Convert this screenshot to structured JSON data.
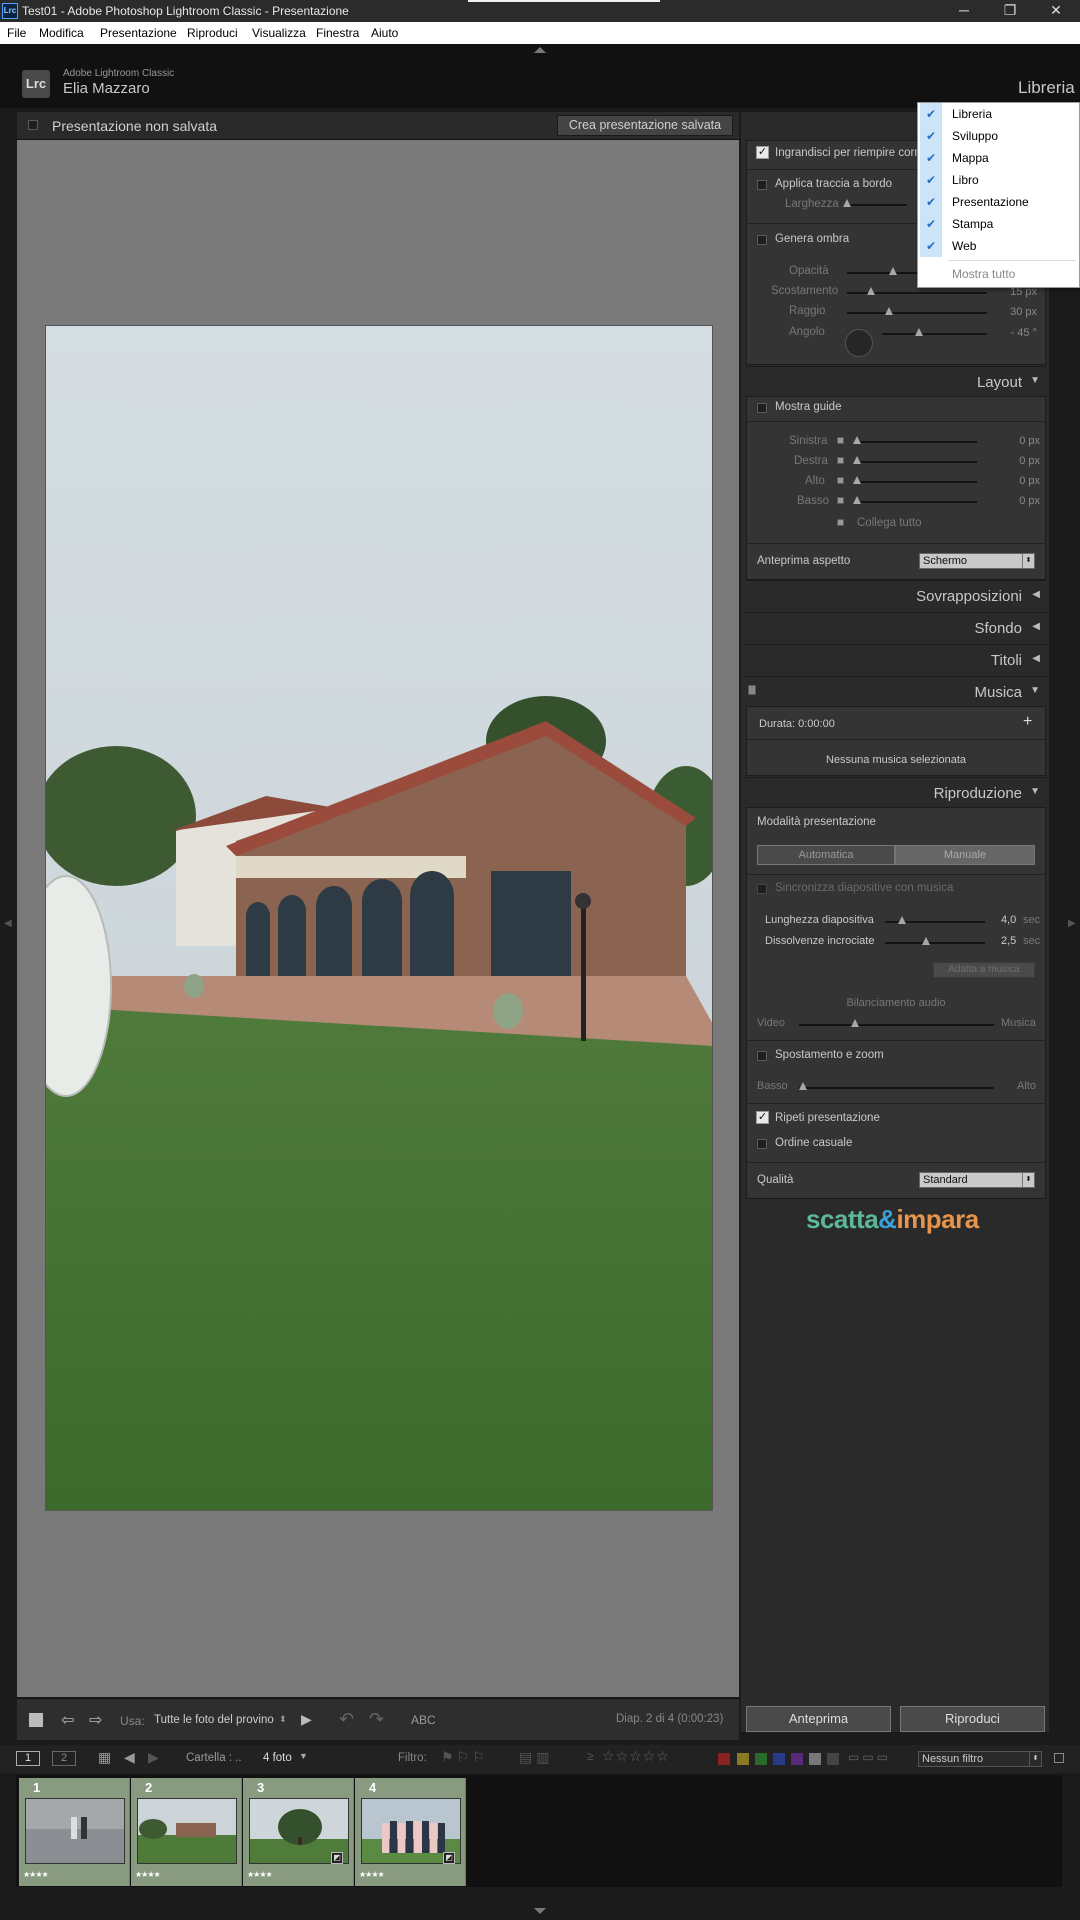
{
  "window": {
    "title": "Test01 - Adobe Photoshop Lightroom Classic - Presentazione",
    "app_badge": "Lrc",
    "minimize": "─",
    "restore": "❐",
    "close": "✕"
  },
  "menu": [
    "File",
    "Modifica",
    "Presentazione",
    "Riproduci",
    "Visualizza",
    "Finestra",
    "Aiuto"
  ],
  "identity": {
    "app": "Adobe Lightroom Classic",
    "user": "Elia Mazzaro",
    "logo": "Lrc",
    "module": "Libreria"
  },
  "collection": {
    "name": "Presentazione non salvata",
    "save_button": "Crea presentazione salvata"
  },
  "dropdown": {
    "items": [
      "Libreria",
      "Sviluppo",
      "Mappa",
      "Libro",
      "Presentazione",
      "Stampa",
      "Web"
    ],
    "show_all": "Mostra tutto"
  },
  "options": {
    "zoom_fill": "Ingrandisci per riempire cornice",
    "stroke_border": "Applica traccia a bordo",
    "width": "Larghezza",
    "cast_shadow": "Genera ombra",
    "opacity": "Opacità",
    "offset": "Scostamento",
    "radius": "Raggio",
    "angle": "Angolo",
    "offset_val": "15 px",
    "radius_val": "30 px",
    "angle_val": "- 45 °"
  },
  "layout": {
    "header": "Layout",
    "show_guides": "Mostra guide",
    "left": "Sinistra",
    "right": "Destra",
    "top": "Alto",
    "bottom": "Basso",
    "zero": "0 px",
    "link_all": "Collega tutto",
    "aspect_label": "Anteprima aspetto",
    "aspect_value": "Schermo"
  },
  "sections": {
    "overlays": "Sovrapposizioni",
    "backdrop": "Sfondo",
    "titles": "Titoli",
    "music": "Musica",
    "playback": "Riproduzione"
  },
  "music": {
    "duration": "Durata: 0:00:00",
    "add": "+",
    "none": "Nessuna musica selezionata"
  },
  "playback": {
    "mode_label": "Modalità presentazione",
    "auto": "Automatica",
    "manual": "Manuale",
    "sync": "Sincronizza diapositive con musica",
    "slide_len": "Lunghezza diapositiva",
    "slide_len_val": "4,0",
    "crossfade": "Dissolvenze incrociate",
    "crossfade_val": "2,5",
    "sec": "sec",
    "fit_music": "Adatta a musica",
    "audio_balance": "Bilanciamento audio",
    "video": "Video",
    "music": "Musica",
    "pan_zoom": "Spostamento e zoom",
    "low": "Basso",
    "high": "Alto",
    "repeat": "Ripeti presentazione",
    "random": "Ordine casuale",
    "quality_label": "Qualità",
    "quality_value": "Standard"
  },
  "brand": {
    "part1": "scatta",
    "amp": "&",
    "part2": "impara"
  },
  "toolbar": {
    "use_label": "Usa:",
    "use_value": "Tutte le foto del provino",
    "abc": "ABC",
    "status": "Diap. 2 di 4 (0:00:23)"
  },
  "buttons": {
    "preview": "Anteprima",
    "play": "Riproduci"
  },
  "filmbar": {
    "screen1": "1",
    "screen2": "2",
    "source": "Cartella : ..",
    "count": "4 foto",
    "filter_label": "Filtro:",
    "filter_value": "Nessun filtro"
  },
  "thumbnails": [
    {
      "num": "1",
      "stars": "★★★★"
    },
    {
      "num": "2",
      "stars": "★★★★"
    },
    {
      "num": "3",
      "stars": "★★★★"
    },
    {
      "num": "4",
      "stars": "★★★★"
    }
  ],
  "colors": {
    "accent_blue": "#2b6fc0",
    "panel": "#343434",
    "stage": "#7a7a7a",
    "brand_green": "#5bb89a",
    "brand_orange": "#e8944a"
  }
}
